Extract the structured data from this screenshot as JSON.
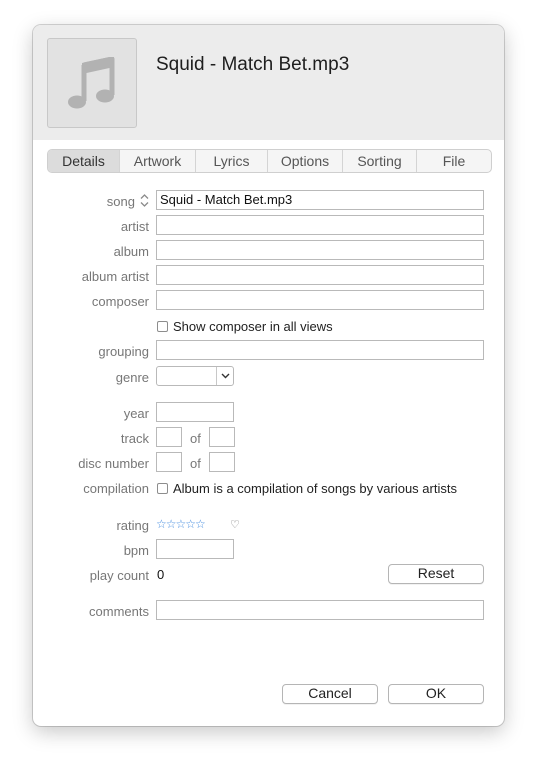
{
  "header": {
    "title": "Squid - Match Bet.mp3"
  },
  "tabs": [
    "Details",
    "Artwork",
    "Lyrics",
    "Options",
    "Sorting",
    "File"
  ],
  "labels": {
    "song": "song",
    "artist": "artist",
    "album": "album",
    "album_artist": "album artist",
    "composer": "composer",
    "grouping": "grouping",
    "genre": "genre",
    "year": "year",
    "track": "track",
    "disc_number": "disc number",
    "compilation": "compilation",
    "rating": "rating",
    "bpm": "bpm",
    "play_count": "play count",
    "comments": "comments"
  },
  "fields": {
    "song": "Squid - Match Bet.mp3",
    "artist": "",
    "album": "",
    "album_artist": "",
    "composer": "",
    "grouping": "",
    "genre": "",
    "year": "",
    "track": "",
    "track_total": "",
    "disc": "",
    "disc_total": "",
    "bpm": "",
    "comments": ""
  },
  "of_text": "of",
  "checkboxes": {
    "show_composer": "Show composer in all views",
    "compilation": "Album is a compilation of songs by various artists"
  },
  "rating": {
    "stars": "☆☆☆☆☆",
    "value": 0,
    "max": 5,
    "heart": "♡"
  },
  "play_count": "0",
  "buttons": {
    "reset": "Reset",
    "cancel": "Cancel",
    "ok": "OK"
  },
  "colors": {
    "star": "#4a8fe0",
    "header_bg": "#ececec",
    "tab_active": "#dcdcdc"
  },
  "icons": {
    "artwork": "music-note-icon",
    "song_sort": "up-down-chevron-icon",
    "genre_dropdown": "chevron-down-icon"
  }
}
